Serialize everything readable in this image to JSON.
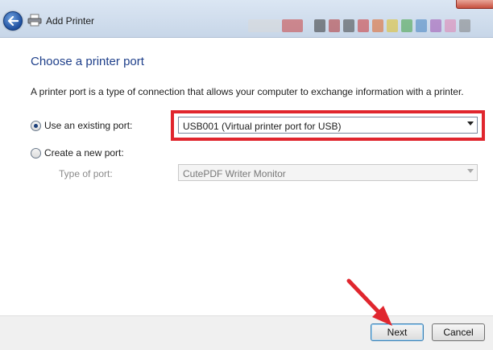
{
  "window": {
    "title": "Add Printer"
  },
  "page": {
    "heading": "Choose a printer port",
    "description": "A printer port is a type of connection that allows your computer to exchange information with a printer."
  },
  "options": {
    "existing": {
      "label": "Use an existing port:",
      "selected": true,
      "value": "USB001 (Virtual printer port for USB)"
    },
    "new": {
      "label": "Create a new port:",
      "selected": false,
      "type_label": "Type of port:",
      "type_value": "CutePDF Writer Monitor"
    }
  },
  "buttons": {
    "next": "Next",
    "cancel": "Cancel"
  },
  "colors": {
    "highlight": "#e0262e",
    "heading": "#1e3f8a"
  },
  "icons": {
    "back": "back-arrow-icon",
    "printer": "printer-icon",
    "annotation": "red-arrow-icon"
  }
}
